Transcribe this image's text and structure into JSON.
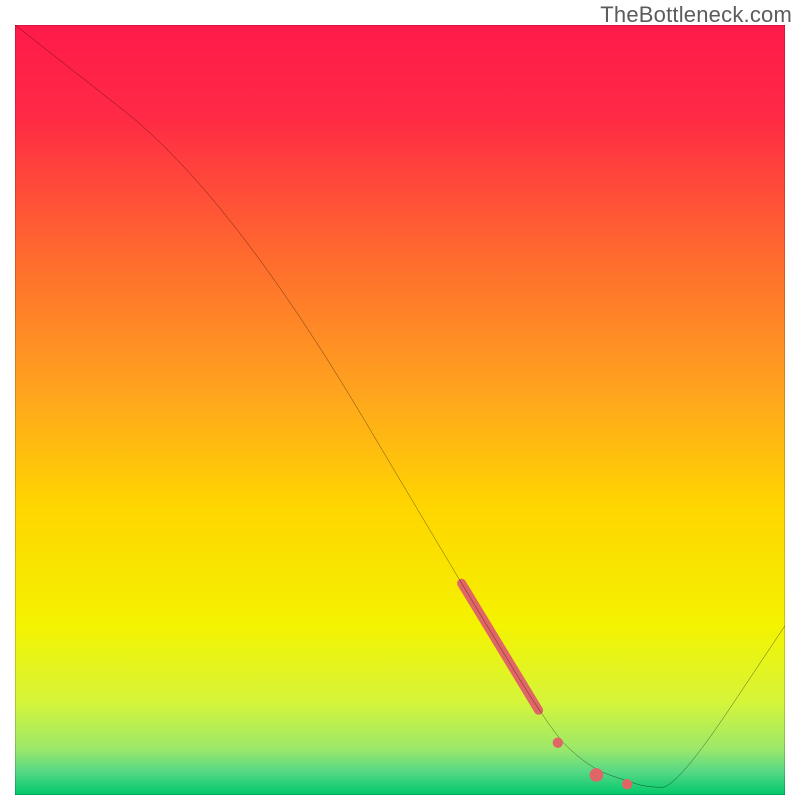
{
  "watermark": "TheBottleneck.com",
  "chart_data": {
    "type": "line",
    "title": "",
    "xlabel": "",
    "ylabel": "",
    "xlim": [
      0,
      100
    ],
    "ylim": [
      0,
      100
    ],
    "grid": false,
    "background_gradient_top": "#ff1a4a",
    "background_gradient_mid": "#ffd400",
    "background_gradient_bottom": "#00c96b",
    "series": [
      {
        "name": "bottleneck-curve",
        "x": [
          0,
          28,
          63,
          70,
          73,
          76,
          79,
          82,
          86,
          100
        ],
        "y": [
          100,
          78,
          19,
          8,
          5,
          3,
          2,
          1,
          1,
          22
        ],
        "color": "#000000",
        "width": 1.6
      }
    ],
    "highlights": [
      {
        "name": "highlight-segment-main",
        "kind": "thick-segment",
        "x": [
          58,
          68
        ],
        "y": [
          27.5,
          11
        ],
        "color": "#e06666",
        "width": 9
      },
      {
        "name": "highlight-dot-1",
        "kind": "dot",
        "x": 70.5,
        "y": 6.8,
        "color": "#e06666",
        "r": 5.2
      },
      {
        "name": "highlight-dot-2",
        "kind": "dot",
        "x": 75.5,
        "y": 2.6,
        "color": "#e06666",
        "r": 6.8
      },
      {
        "name": "highlight-dot-3",
        "kind": "dot",
        "x": 79.5,
        "y": 1.4,
        "color": "#e06666",
        "r": 5.2
      }
    ]
  }
}
